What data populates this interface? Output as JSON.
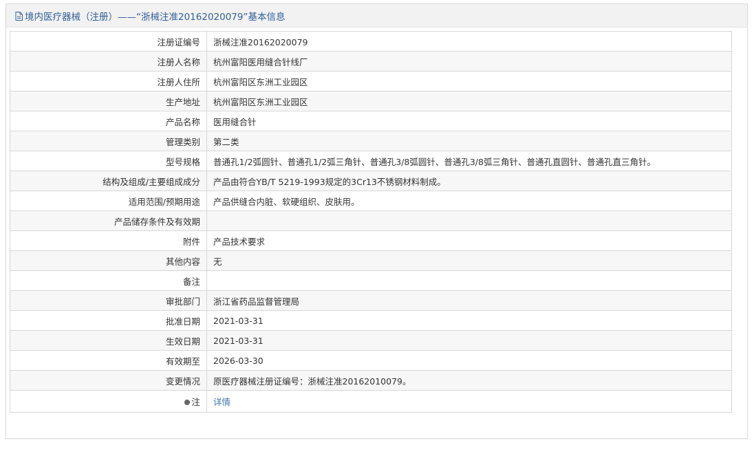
{
  "header": {
    "title": "境内医疗器械（注册）——“浙械注准20162020079”基本信息",
    "icon": "document-icon",
    "color": "#2f5f9c"
  },
  "rows": [
    {
      "label": "注册证编号",
      "value": "浙械注准20162020079"
    },
    {
      "label": "注册人名称",
      "value": "杭州富阳医用缝合针线厂"
    },
    {
      "label": "注册人住所",
      "value": "杭州富阳区东洲工业园区"
    },
    {
      "label": "生产地址",
      "value": "杭州富阳区东洲工业园区"
    },
    {
      "label": "产品名称",
      "value": "医用缝合针"
    },
    {
      "label": "管理类别",
      "value": "第二类"
    },
    {
      "label": "型号规格",
      "value": "普通孔1/2弧圆针、普通孔1/2弧三角针、普通孔3/8弧圆针、普通孔3/8弧三角针、普通孔直圆针、普通孔直三角针。"
    },
    {
      "label": "结构及组成/主要组成成分",
      "value": "产品由符合YB/T 5219-1993规定的3Cr13不锈钢材料制成。"
    },
    {
      "label": "适用范围/预期用途",
      "value": "产品供缝合内脏、软硬组织、皮肤用。"
    },
    {
      "label": "产品储存条件及有效期",
      "value": ""
    },
    {
      "label": "附件",
      "value": "产品技术要求"
    },
    {
      "label": "其他内容",
      "value": "无"
    },
    {
      "label": "备注",
      "value": ""
    },
    {
      "label": "审批部门",
      "value": "浙江省药品监督管理局"
    },
    {
      "label": "批准日期",
      "value": "2021-03-31"
    },
    {
      "label": "生效日期",
      "value": "2021-03-31"
    },
    {
      "label": "有效期至",
      "value": "2026-03-30"
    },
    {
      "label": "变更情况",
      "value": "原医疗器械注册证编号：浙械注准20162010079。"
    }
  ],
  "note_row": {
    "label": "注",
    "icon": "note-bullet-icon",
    "link_text": "详情",
    "link_color": "#3c76bd"
  }
}
